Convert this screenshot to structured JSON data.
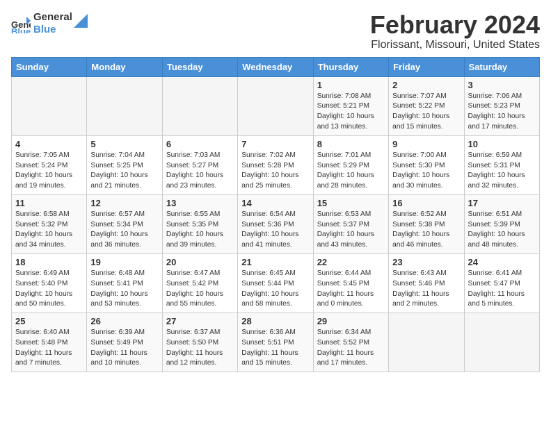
{
  "header": {
    "logo_line1": "General",
    "logo_line2": "Blue",
    "title": "February 2024",
    "subtitle": "Florissant, Missouri, United States"
  },
  "weekdays": [
    "Sunday",
    "Monday",
    "Tuesday",
    "Wednesday",
    "Thursday",
    "Friday",
    "Saturday"
  ],
  "weeks": [
    [
      {
        "day": "",
        "info": ""
      },
      {
        "day": "",
        "info": ""
      },
      {
        "day": "",
        "info": ""
      },
      {
        "day": "",
        "info": ""
      },
      {
        "day": "1",
        "info": "Sunrise: 7:08 AM\nSunset: 5:21 PM\nDaylight: 10 hours\nand 13 minutes."
      },
      {
        "day": "2",
        "info": "Sunrise: 7:07 AM\nSunset: 5:22 PM\nDaylight: 10 hours\nand 15 minutes."
      },
      {
        "day": "3",
        "info": "Sunrise: 7:06 AM\nSunset: 5:23 PM\nDaylight: 10 hours\nand 17 minutes."
      }
    ],
    [
      {
        "day": "4",
        "info": "Sunrise: 7:05 AM\nSunset: 5:24 PM\nDaylight: 10 hours\nand 19 minutes."
      },
      {
        "day": "5",
        "info": "Sunrise: 7:04 AM\nSunset: 5:25 PM\nDaylight: 10 hours\nand 21 minutes."
      },
      {
        "day": "6",
        "info": "Sunrise: 7:03 AM\nSunset: 5:27 PM\nDaylight: 10 hours\nand 23 minutes."
      },
      {
        "day": "7",
        "info": "Sunrise: 7:02 AM\nSunset: 5:28 PM\nDaylight: 10 hours\nand 25 minutes."
      },
      {
        "day": "8",
        "info": "Sunrise: 7:01 AM\nSunset: 5:29 PM\nDaylight: 10 hours\nand 28 minutes."
      },
      {
        "day": "9",
        "info": "Sunrise: 7:00 AM\nSunset: 5:30 PM\nDaylight: 10 hours\nand 30 minutes."
      },
      {
        "day": "10",
        "info": "Sunrise: 6:59 AM\nSunset: 5:31 PM\nDaylight: 10 hours\nand 32 minutes."
      }
    ],
    [
      {
        "day": "11",
        "info": "Sunrise: 6:58 AM\nSunset: 5:32 PM\nDaylight: 10 hours\nand 34 minutes."
      },
      {
        "day": "12",
        "info": "Sunrise: 6:57 AM\nSunset: 5:34 PM\nDaylight: 10 hours\nand 36 minutes."
      },
      {
        "day": "13",
        "info": "Sunrise: 6:55 AM\nSunset: 5:35 PM\nDaylight: 10 hours\nand 39 minutes."
      },
      {
        "day": "14",
        "info": "Sunrise: 6:54 AM\nSunset: 5:36 PM\nDaylight: 10 hours\nand 41 minutes."
      },
      {
        "day": "15",
        "info": "Sunrise: 6:53 AM\nSunset: 5:37 PM\nDaylight: 10 hours\nand 43 minutes."
      },
      {
        "day": "16",
        "info": "Sunrise: 6:52 AM\nSunset: 5:38 PM\nDaylight: 10 hours\nand 46 minutes."
      },
      {
        "day": "17",
        "info": "Sunrise: 6:51 AM\nSunset: 5:39 PM\nDaylight: 10 hours\nand 48 minutes."
      }
    ],
    [
      {
        "day": "18",
        "info": "Sunrise: 6:49 AM\nSunset: 5:40 PM\nDaylight: 10 hours\nand 50 minutes."
      },
      {
        "day": "19",
        "info": "Sunrise: 6:48 AM\nSunset: 5:41 PM\nDaylight: 10 hours\nand 53 minutes."
      },
      {
        "day": "20",
        "info": "Sunrise: 6:47 AM\nSunset: 5:42 PM\nDaylight: 10 hours\nand 55 minutes."
      },
      {
        "day": "21",
        "info": "Sunrise: 6:45 AM\nSunset: 5:44 PM\nDaylight: 10 hours\nand 58 minutes."
      },
      {
        "day": "22",
        "info": "Sunrise: 6:44 AM\nSunset: 5:45 PM\nDaylight: 11 hours\nand 0 minutes."
      },
      {
        "day": "23",
        "info": "Sunrise: 6:43 AM\nSunset: 5:46 PM\nDaylight: 11 hours\nand 2 minutes."
      },
      {
        "day": "24",
        "info": "Sunrise: 6:41 AM\nSunset: 5:47 PM\nDaylight: 11 hours\nand 5 minutes."
      }
    ],
    [
      {
        "day": "25",
        "info": "Sunrise: 6:40 AM\nSunset: 5:48 PM\nDaylight: 11 hours\nand 7 minutes."
      },
      {
        "day": "26",
        "info": "Sunrise: 6:39 AM\nSunset: 5:49 PM\nDaylight: 11 hours\nand 10 minutes."
      },
      {
        "day": "27",
        "info": "Sunrise: 6:37 AM\nSunset: 5:50 PM\nDaylight: 11 hours\nand 12 minutes."
      },
      {
        "day": "28",
        "info": "Sunrise: 6:36 AM\nSunset: 5:51 PM\nDaylight: 11 hours\nand 15 minutes."
      },
      {
        "day": "29",
        "info": "Sunrise: 6:34 AM\nSunset: 5:52 PM\nDaylight: 11 hours\nand 17 minutes."
      },
      {
        "day": "",
        "info": ""
      },
      {
        "day": "",
        "info": ""
      }
    ]
  ]
}
